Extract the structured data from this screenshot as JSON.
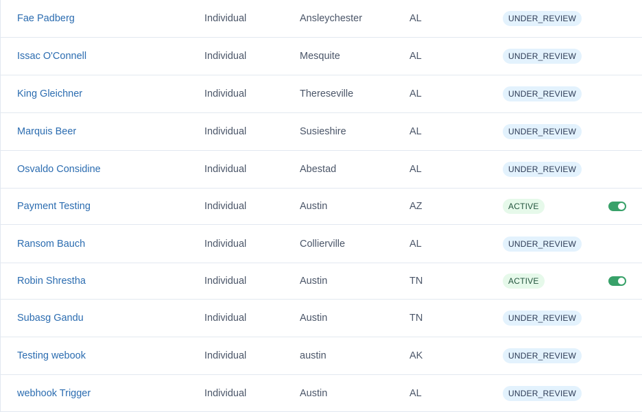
{
  "rows": [
    {
      "name": "Fae Padberg",
      "type": "Individual",
      "city": "Ansleychester",
      "state": "AL",
      "status": "UNDER_REVIEW",
      "toggle": false
    },
    {
      "name": "Issac O'Connell",
      "type": "Individual",
      "city": "Mesquite",
      "state": "AL",
      "status": "UNDER_REVIEW",
      "toggle": false
    },
    {
      "name": "King Gleichner",
      "type": "Individual",
      "city": "Thereseville",
      "state": "AL",
      "status": "UNDER_REVIEW",
      "toggle": false
    },
    {
      "name": "Marquis Beer",
      "type": "Individual",
      "city": "Susieshire",
      "state": "AL",
      "status": "UNDER_REVIEW",
      "toggle": false
    },
    {
      "name": "Osvaldo Considine",
      "type": "Individual",
      "city": "Abestad",
      "state": "AL",
      "status": "UNDER_REVIEW",
      "toggle": false
    },
    {
      "name": "Payment Testing",
      "type": "Individual",
      "city": "Austin",
      "state": "AZ",
      "status": "ACTIVE",
      "toggle": true
    },
    {
      "name": "Ransom Bauch",
      "type": "Individual",
      "city": "Collierville",
      "state": "AL",
      "status": "UNDER_REVIEW",
      "toggle": false
    },
    {
      "name": "Robin Shrestha",
      "type": "Individual",
      "city": "Austin",
      "state": "TN",
      "status": "ACTIVE",
      "toggle": true
    },
    {
      "name": "Subasg Gandu",
      "type": "Individual",
      "city": "Austin",
      "state": "TN",
      "status": "UNDER_REVIEW",
      "toggle": false
    },
    {
      "name": "Testing webook",
      "type": "Individual",
      "city": "austin",
      "state": "AK",
      "status": "UNDER_REVIEW",
      "toggle": false
    },
    {
      "name": "webhook Trigger",
      "type": "Individual",
      "city": "Austin",
      "state": "AL",
      "status": "UNDER_REVIEW",
      "toggle": false
    }
  ],
  "colors": {
    "link": "#2b6cb0",
    "review_badge_bg": "#e3f2fd",
    "active_badge_bg": "#e6f9ea",
    "toggle_on": "#38a169"
  }
}
